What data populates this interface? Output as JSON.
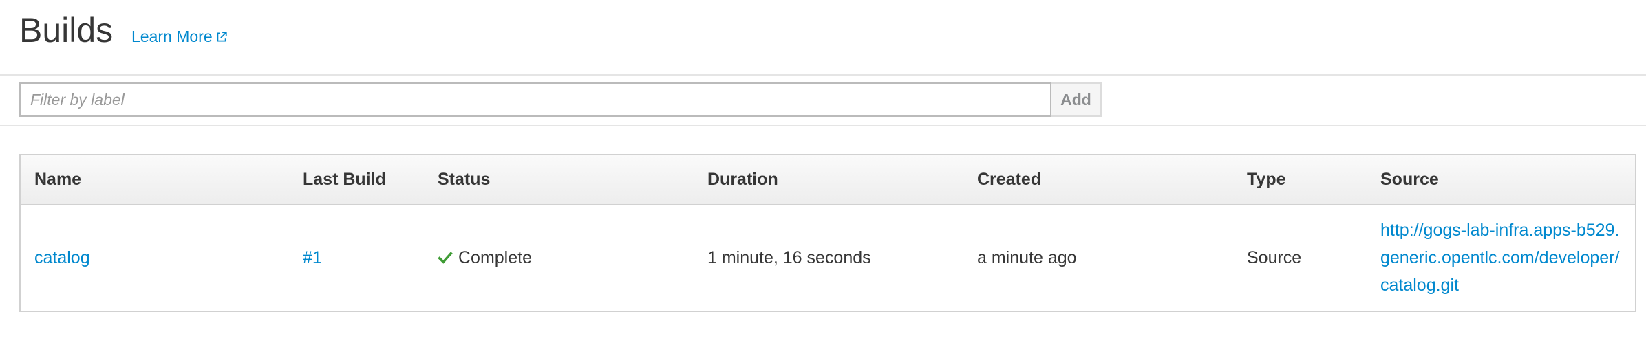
{
  "header": {
    "title": "Builds",
    "learn_more_label": "Learn More"
  },
  "filter": {
    "placeholder": "Filter by label",
    "value": "",
    "add_label": "Add"
  },
  "table": {
    "columns": [
      "Name",
      "Last Build",
      "Status",
      "Duration",
      "Created",
      "Type",
      "Source"
    ],
    "rows": [
      {
        "name": "catalog",
        "last_build": "#1",
        "status": "Complete",
        "status_icon": "check-icon",
        "duration": "1 minute, 16 seconds",
        "created": "a minute ago",
        "type": "Source",
        "source": "http://gogs-lab-infra.apps-b529.generic.opentlc.com/developer/catalog.git"
      }
    ]
  },
  "colors": {
    "link": "#0088ce",
    "success": "#3f9c35",
    "text": "#363636"
  }
}
